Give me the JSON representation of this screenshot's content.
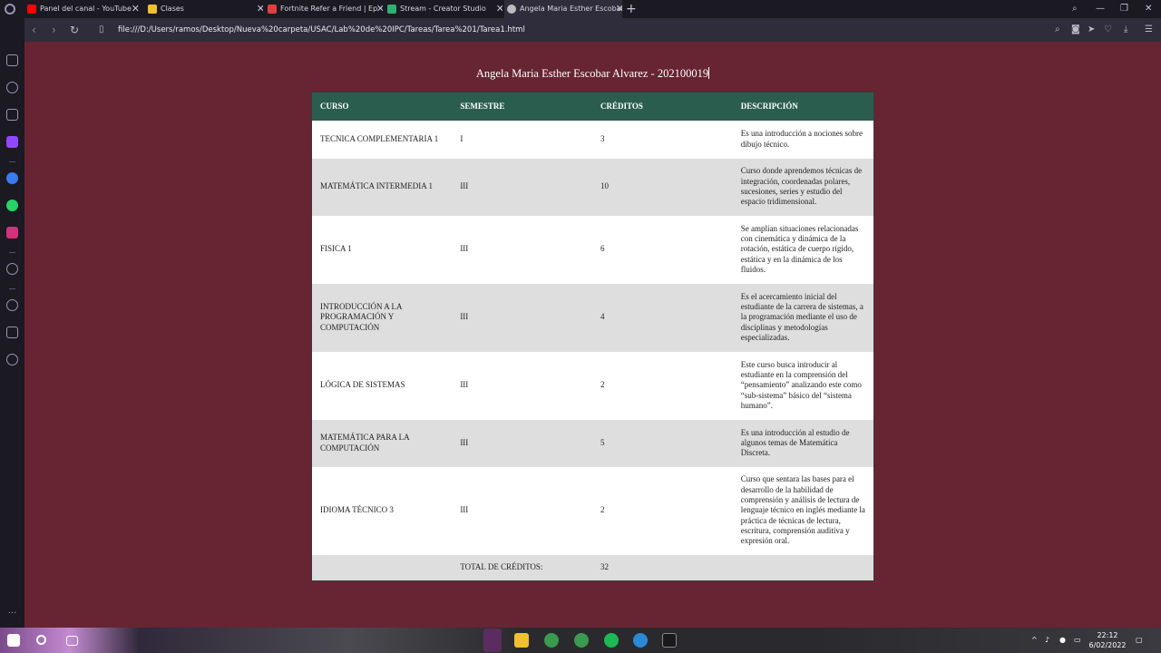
{
  "browser": {
    "tabs": [
      {
        "title": "Panel del canal - YouTube",
        "icon_color": "#ff0000"
      },
      {
        "title": "Clases",
        "icon_color": "#f0c030"
      },
      {
        "title": "Fortnite Refer a Friend | Ep",
        "icon_color": "#e04040"
      },
      {
        "title": "Stream - Creator Studio",
        "icon_color": "#30b070"
      },
      {
        "title": "Angela Maria Esther Escobar",
        "icon_color": "#bcbcbc"
      }
    ],
    "url": "file:///D:/Users/ramos/Desktop/Nueva%20carpeta/USAC/Lab%20de%20IPC/Tareas/Tarea%201/Tarea1.html"
  },
  "page": {
    "heading": "Angela Maria Esther Escobar Alvarez - 202100019",
    "headers": [
      "CURSO",
      "SEMESTRE",
      "CRÉDITOS",
      "DESCRIPCIÓN"
    ],
    "rows": [
      {
        "curso": "TECNICA COMPLEMENTARIA 1",
        "semestre": "I",
        "creditos": "3",
        "descripcion": "Es una introducción a nociones sobre dibujo técnico."
      },
      {
        "curso": "MATEMÁTICA INTERMEDIA 1",
        "semestre": "III",
        "creditos": "10",
        "descripcion": "Curso donde aprendemos técnicas de integración, coordenadas polares, sucesiones, series y estudio del espacio tridimensional."
      },
      {
        "curso": "FISICA 1",
        "semestre": "III",
        "creditos": "6",
        "descripcion": "Se amplían situaciones relacionadas con cinemática y dinámica de la rotación, estática de cuerpo rígido, estática y en la dinámica de los fluidos."
      },
      {
        "curso": "INTRODUCCIÓN A LA PROGRAMACIÓN Y COMPUTACIÓN",
        "semestre": "III",
        "creditos": "4",
        "descripcion": "Es el acercamiento inicial del estudiante de la carrera de sistemas, a la programación mediante el uso de disciplinas y metodologías especializadas."
      },
      {
        "curso": "LÓGICA DE SISTEMAS",
        "semestre": "III",
        "creditos": "2",
        "descripcion": "Este curso busca introducir al estudiante en la comprensión del “pensamiento” analizando este como “sub-sistema” básico del “sistema humano”."
      },
      {
        "curso": "MATEMÁTICA PARA LA COMPUTACIÓN",
        "semestre": "III",
        "creditos": "5",
        "descripcion": "Es una introducción al estudio de algunos temas de Matemática Discreta."
      },
      {
        "curso": "IDIOMA TÉCNICO 3",
        "semestre": "III",
        "creditos": "2",
        "descripcion": "Curso que sentara las bases para el desarrollo de la habilidad de comprensión y análisis de lectura de lenguaje técnico en inglés mediante la práctica de técnicas de lectura, escritura, comprensión auditiva y expresión oral."
      }
    ],
    "total_label": "TOTAL DE CRÉDITOS:",
    "total_value": "32"
  },
  "taskbar": {
    "time": "22:12",
    "date": "6/02/2022"
  },
  "colors": {
    "page_bg": "#672432",
    "header_bg": "#2b5d4f",
    "row_alt": "#dedede"
  }
}
